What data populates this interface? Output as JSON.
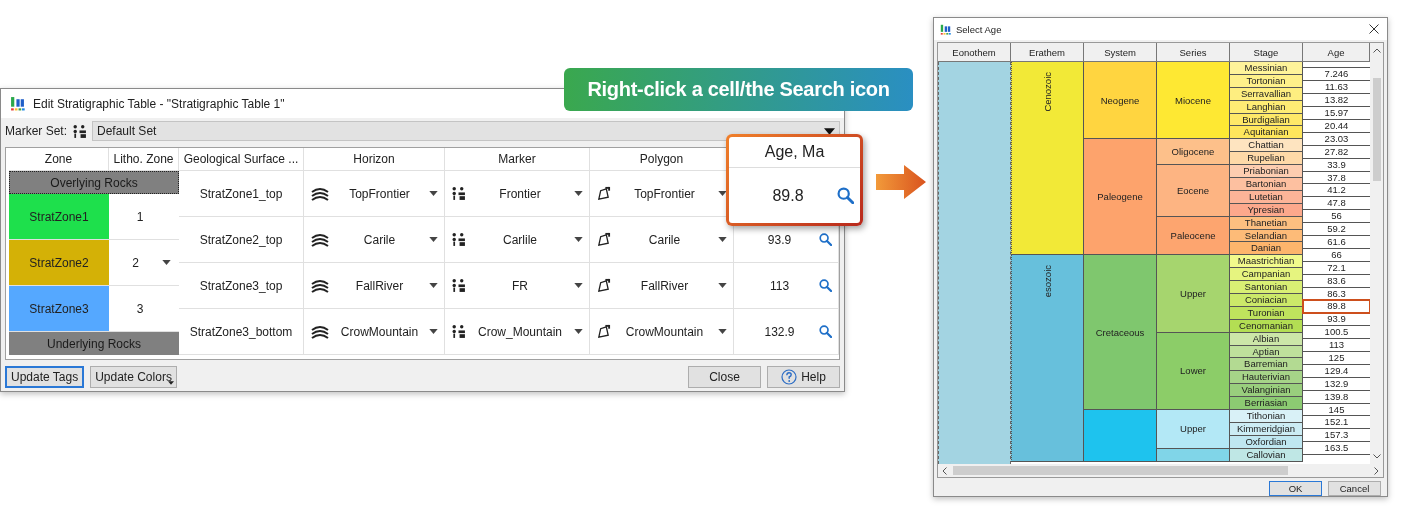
{
  "edit_dialog": {
    "title": "Edit Stratigraphic Table - \"Stratigraphic Table 1\"",
    "marker_set": {
      "label": "Marker Set:",
      "value": "Default Set"
    },
    "columns": [
      "Zone",
      "Litho. Zone",
      "Geological Surface ...",
      "Horizon",
      "Marker",
      "Polygon"
    ],
    "zones": [
      {
        "kind": "boundary",
        "name": "Overlying Rocks",
        "focused": true
      },
      {
        "kind": "zone",
        "name": "StratZone1",
        "color": "#1ee04c",
        "litho": "1",
        "dropdown": false
      },
      {
        "kind": "zone",
        "name": "StratZone2",
        "color": "#d4b106",
        "litho": "2",
        "dropdown": true
      },
      {
        "kind": "zone",
        "name": "StratZone3",
        "color": "#55a8ff",
        "litho": "3",
        "dropdown": false
      },
      {
        "kind": "boundary",
        "name": "Underlying Rocks",
        "focused": false
      }
    ],
    "surfaces": [
      {
        "name": "StratZone1_top",
        "horizon": "TopFrontier",
        "marker": "Frontier",
        "polygon": "TopFrontier"
      },
      {
        "name": "StratZone2_top",
        "horizon": "Carile",
        "marker": "Carlile",
        "polygon": "Carile",
        "age": "93.9"
      },
      {
        "name": "StratZone3_top",
        "horizon": "FallRiver",
        "marker": "FR",
        "polygon": "FallRiver",
        "age": "113"
      },
      {
        "name": "StratZone3_bottom",
        "horizon": "CrowMountain",
        "marker": "Crow_Mountain",
        "polygon": "CrowMountain",
        "age": "132.9"
      }
    ],
    "buttons": [
      {
        "label": "Update Tags",
        "focused": true,
        "menu": false
      },
      {
        "label": "Update Colors",
        "focused": false,
        "menu": true
      }
    ],
    "close": "Close",
    "help": "Help"
  },
  "banner": "Right-click a cell/the Search icon",
  "callout": {
    "column": "Age, Ma",
    "value": "89.8"
  },
  "select_age": {
    "title": "Select Age",
    "columns": [
      "Eonothem",
      "Erathem",
      "System",
      "Series",
      "Stage",
      "Age"
    ],
    "erathems": [
      {
        "name": "Cenozoic",
        "color": "#f2e937",
        "systems": [
          {
            "name": "Neogene",
            "color": "#ffd540",
            "series": [
              {
                "name": "Miocene",
                "color": "#fee833",
                "stages": [
                  {
                    "name": "Messinian",
                    "color": "#fef39a"
                  },
                  {
                    "name": "Tortonian",
                    "color": "#fef08a"
                  },
                  {
                    "name": "Serravallian",
                    "color": "#feee80"
                  },
                  {
                    "name": "Langhian",
                    "color": "#feec74"
                  },
                  {
                    "name": "Burdigalian",
                    "color": "#fee868"
                  },
                  {
                    "name": "Aquitanian",
                    "color": "#fee65c"
                  }
                ]
              }
            ]
          },
          {
            "name": "Paleogene",
            "color": "#fda36c",
            "series": [
              {
                "name": "Oligocene",
                "color": "#fdc08a",
                "stages": [
                  {
                    "name": "Chattian",
                    "color": "#fee4c0"
                  },
                  {
                    "name": "Rupelian",
                    "color": "#fed9a8"
                  }
                ]
              },
              {
                "name": "Eocene",
                "color": "#fdb482",
                "stages": [
                  {
                    "name": "Priabonian",
                    "color": "#fdcdb0"
                  },
                  {
                    "name": "Bartonian",
                    "color": "#fdc0a0"
                  },
                  {
                    "name": "Lutetian",
                    "color": "#fcb498"
                  },
                  {
                    "name": "Ypresian",
                    "color": "#fca88c"
                  }
                ]
              },
              {
                "name": "Paleocene",
                "color": "#fda56f",
                "stages": [
                  {
                    "name": "Thanetian",
                    "color": "#fdbf80"
                  },
                  {
                    "name": "Selandian",
                    "color": "#fdbb78"
                  },
                  {
                    "name": "Danian",
                    "color": "#fdb56c"
                  }
                ]
              }
            ]
          }
        ]
      },
      {
        "name": "esozoic",
        "color": "#67c0dc",
        "systems": [
          {
            "name": "Cretaceous",
            "color": "#7fc76e",
            "series": [
              {
                "name": "Upper",
                "color": "#a6d56e",
                "stages": [
                  {
                    "name": "Maastrichtian",
                    "color": "#f2fa8c"
                  },
                  {
                    "name": "Campanian",
                    "color": "#e6f47f"
                  },
                  {
                    "name": "Santonian",
                    "color": "#d9ef74"
                  },
                  {
                    "name": "Coniacian",
                    "color": "#cce969"
                  },
                  {
                    "name": "Turonian",
                    "color": "#bfe35d"
                  },
                  {
                    "name": "Cenomanian",
                    "color": "#b3de53"
                  }
                ]
              },
              {
                "name": "Lower",
                "color": "#8ccd68",
                "stages": [
                  {
                    "name": "Albian",
                    "color": "#cce6a8"
                  },
                  {
                    "name": "Aptian",
                    "color": "#bfe09c"
                  },
                  {
                    "name": "Barremian",
                    "color": "#b3da92"
                  },
                  {
                    "name": "Hauterivian",
                    "color": "#a6d488"
                  },
                  {
                    "name": "Valanginian",
                    "color": "#99ce7d"
                  },
                  {
                    "name": "Berriasian",
                    "color": "#8ccb72"
                  }
                ]
              }
            ]
          },
          {
            "color": "#1ec3ee",
            "series": [
              {
                "name": "Upper",
                "color": "#b3e8f6",
                "stages": [
                  {
                    "name": "Tithonian",
                    "color": "#d9f1f7"
                  },
                  {
                    "name": "Kimmeridgian",
                    "color": "#ccecf4"
                  },
                  {
                    "name": "Oxfordian",
                    "color": "#bfe7f1"
                  }
                ]
              },
              {
                "color": "#80d5e8",
                "stages": [
                  {
                    "name": "Callovian",
                    "color": "#bfe7e5"
                  }
                ]
              }
            ]
          }
        ]
      }
    ],
    "ages": [
      {
        "value": "7.246",
        "selected": false
      },
      {
        "value": "11.63",
        "selected": false
      },
      {
        "value": "13.82",
        "selected": false
      },
      {
        "value": "15.97",
        "selected": false
      },
      {
        "value": "20.44",
        "selected": false
      },
      {
        "value": "23.03",
        "selected": false
      },
      {
        "value": "27.82",
        "selected": false
      },
      {
        "value": "33.9",
        "selected": false
      },
      {
        "value": "37.8",
        "selected": false
      },
      {
        "value": "41.2",
        "selected": false
      },
      {
        "value": "47.8",
        "selected": false
      },
      {
        "value": "56",
        "selected": false
      },
      {
        "value": "59.2",
        "selected": false
      },
      {
        "value": "61.6",
        "selected": false
      },
      {
        "value": "66",
        "selected": false
      },
      {
        "value": "72.1",
        "selected": false
      },
      {
        "value": "83.6",
        "selected": false
      },
      {
        "value": "86.3",
        "selected": false
      },
      {
        "value": "89.8",
        "selected": true
      },
      {
        "value": "93.9",
        "selected": false
      },
      {
        "value": "100.5",
        "selected": false
      },
      {
        "value": "113",
        "selected": false
      },
      {
        "value": "125",
        "selected": false
      },
      {
        "value": "129.4",
        "selected": false
      },
      {
        "value": "132.9",
        "selected": false
      },
      {
        "value": "139.8",
        "selected": false
      },
      {
        "value": "145",
        "selected": false
      },
      {
        "value": "152.1",
        "selected": false
      },
      {
        "value": "157.3",
        "selected": false
      },
      {
        "value": "163.5",
        "selected": false
      }
    ],
    "buttons": [
      {
        "label": "OK",
        "default": true
      },
      {
        "label": "Cancel",
        "default": false
      }
    ]
  }
}
